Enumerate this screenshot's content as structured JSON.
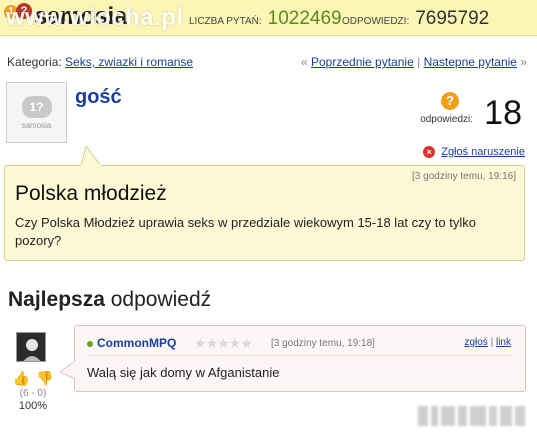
{
  "header": {
    "logo_badge_1": "1",
    "logo_badge_2": "?",
    "brand": "samosia",
    "watermark": "www.wiocha.pl",
    "questions_label": "LICZBA PYTAŃ:",
    "questions_count": "1022469",
    "answers_label": "ODPOWIEDZI:",
    "answers_count": "7695792",
    "accent_color": "#5a8a1e"
  },
  "category": {
    "label": "Kategoria:",
    "value": "Seks, zwiazki i romanse",
    "prev_marker": "«",
    "prev_link": "Poprzednie pytanie",
    "divider": "|",
    "next_link": "Nastepne pytanie",
    "next_marker": "»"
  },
  "asker": {
    "avatar_badge": "1?",
    "avatar_text": "samosia",
    "name": "gość"
  },
  "answer_count": {
    "icon": "?",
    "label": "odpowiedzi:",
    "value": "18"
  },
  "report": {
    "icon": "×",
    "label": "Zgłoś naruszenie"
  },
  "question": {
    "time": "[3 godziny temu, 19:16]",
    "title": "Polska młodzież",
    "body": "Czy Polska Młodzież uprawia seks w przedziale wiekowym 15-18 lat czy to tylko pozory?"
  },
  "best_answer": {
    "title_bold": "Najlepsza",
    "title_rest": " odpowiedź",
    "thumb_up_icon": "👍",
    "thumb_down_icon": "👎",
    "votes": "(6 - 0)",
    "percent": "100%",
    "user": "CommonMPQ",
    "stars": "★★★★★",
    "time": "[3 godziny temu, 19:18]",
    "report_link": "zgłoś",
    "link_divider": "|",
    "link_link": "link",
    "text": "Walą się jak domy w Afganistanie"
  }
}
